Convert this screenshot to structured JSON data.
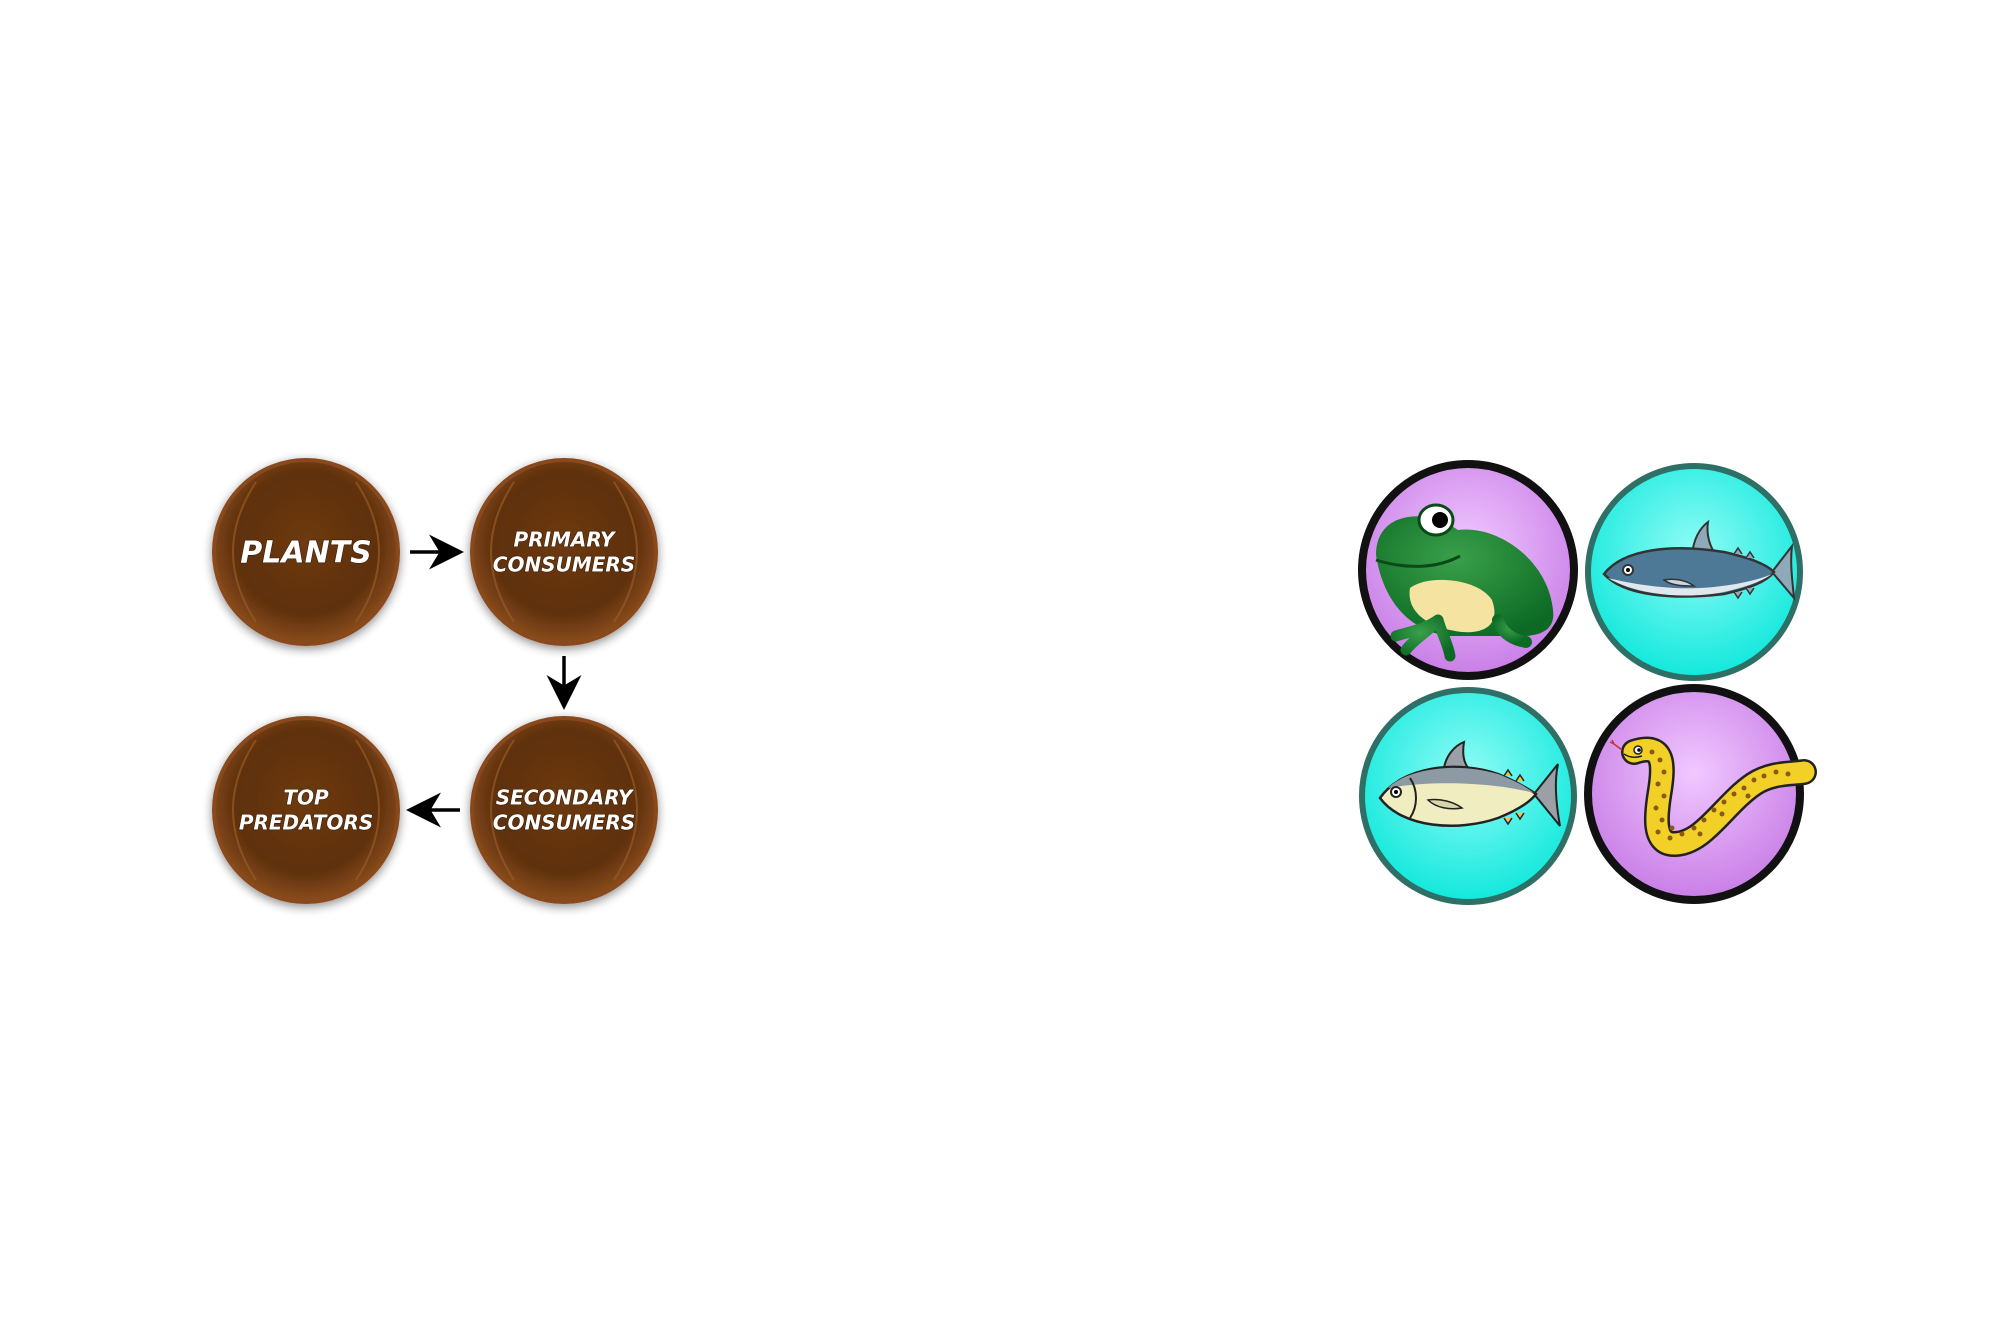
{
  "food_chain": {
    "nodes": [
      {
        "id": "plants",
        "lines": [
          "PLANTS"
        ]
      },
      {
        "id": "primary-consumers",
        "lines": [
          "PRIMARY",
          "CONSUMERS"
        ]
      },
      {
        "id": "secondary-consumers",
        "lines": [
          "SECONDARY",
          "CONSUMERS"
        ]
      },
      {
        "id": "top-predators",
        "lines": [
          "TOP",
          "PREDATORS"
        ]
      }
    ],
    "edges": [
      {
        "from": "plants",
        "to": "primary-consumers"
      },
      {
        "from": "primary-consumers",
        "to": "secondary-consumers"
      },
      {
        "from": "secondary-consumers",
        "to": "top-predators"
      }
    ]
  },
  "organisms": [
    {
      "name": "frog",
      "icon": "frog-icon",
      "background": "#d58ef0",
      "border": "#111111"
    },
    {
      "name": "mackerel",
      "icon": "mackerel-icon",
      "background": "#18f0e6",
      "border": "#2e6f66"
    },
    {
      "name": "tuna",
      "icon": "tuna-icon",
      "background": "#18f0e6",
      "border": "#2e6f66"
    },
    {
      "name": "eel",
      "icon": "eel-icon",
      "background": "#d58ef0",
      "border": "#111111"
    }
  ],
  "colors": {
    "node_fill": "#6b3710",
    "node_rim": "#8a4a1a",
    "arrow": "#000000"
  }
}
